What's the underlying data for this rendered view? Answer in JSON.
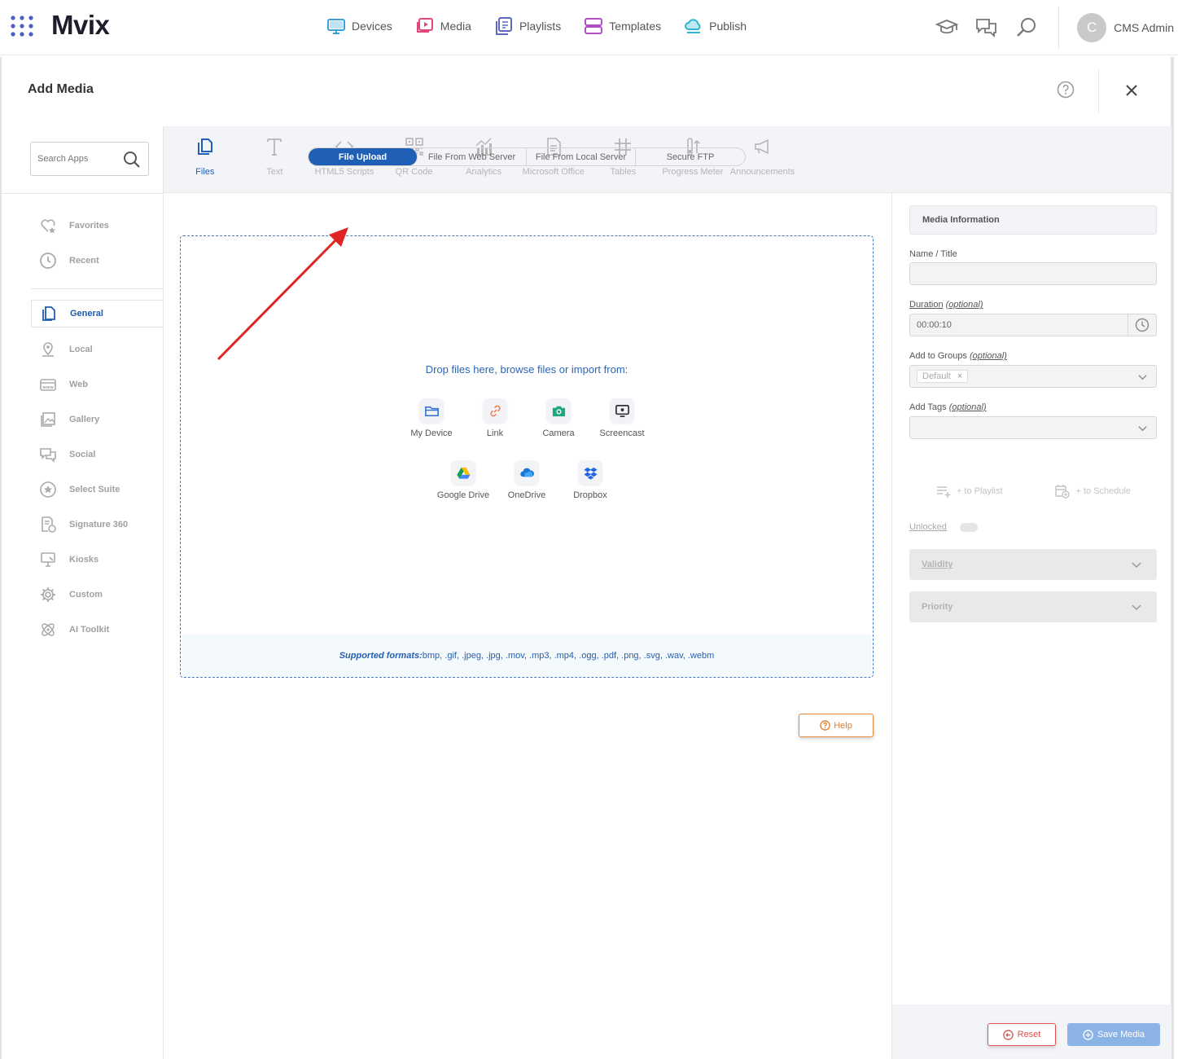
{
  "app": {
    "logo": "Mvix",
    "nav": [
      {
        "label": "Devices",
        "icon": "monitor-icon",
        "color": "#3aa0d8"
      },
      {
        "label": "Media",
        "icon": "media-play-icon",
        "color": "#e0457b"
      },
      {
        "label": "Playlists",
        "icon": "playlist-icon",
        "color": "#5b6abf"
      },
      {
        "label": "Templates",
        "icon": "templates-icon",
        "color": "#b04fc7"
      },
      {
        "label": "Publish",
        "icon": "cloud-publish-icon",
        "color": "#2fb3d0"
      }
    ],
    "user": {
      "initial": "C",
      "name": "CMS Admin"
    }
  },
  "panel": {
    "title": "Add Media",
    "search_placeholder": "Search Apps"
  },
  "sidebar": {
    "top_items": [
      {
        "label": "Favorites",
        "icon": "heart-star-icon"
      },
      {
        "label": "Recent",
        "icon": "clock-icon"
      }
    ],
    "items": [
      {
        "label": "General",
        "icon": "file-copy-icon",
        "active": true
      },
      {
        "label": "Local",
        "icon": "location-pin-icon"
      },
      {
        "label": "Web",
        "icon": "web-icon"
      },
      {
        "label": "Gallery",
        "icon": "gallery-icon"
      },
      {
        "label": "Social",
        "icon": "social-chat-icon"
      },
      {
        "label": "Select Suite",
        "icon": "star-circle-icon"
      },
      {
        "label": "Signature 360",
        "icon": "signature-icon"
      },
      {
        "label": "Kiosks",
        "icon": "kiosk-icon"
      },
      {
        "label": "Custom",
        "icon": "gear-icon"
      },
      {
        "label": "AI Toolkit",
        "icon": "atom-icon"
      }
    ]
  },
  "apps": [
    {
      "label": "Files",
      "icon": "files-icon",
      "active": true
    },
    {
      "label": "Text",
      "icon": "text-icon"
    },
    {
      "label": "HTML5 Scripts",
      "icon": "code-icon"
    },
    {
      "label": "QR Code",
      "icon": "qr-code-icon"
    },
    {
      "label": "Analytics",
      "icon": "analytics-icon"
    },
    {
      "label": "Microsoft Office",
      "icon": "document-icon"
    },
    {
      "label": "Tables",
      "icon": "table-grid-icon"
    },
    {
      "label": "Progress Meter",
      "icon": "progress-meter-icon"
    },
    {
      "label": "Announcements",
      "icon": "megaphone-icon"
    }
  ],
  "tabs": [
    {
      "label": "File Upload",
      "active": true
    },
    {
      "label": "File From Web Server"
    },
    {
      "label": "File From Local Server"
    },
    {
      "label": "Secure FTP"
    }
  ],
  "upload": {
    "prompt": "Drop files here, browse files or import from:",
    "sources_row1": [
      {
        "label": "My Device",
        "icon": "folder-icon"
      },
      {
        "label": "Link",
        "icon": "link-icon"
      },
      {
        "label": "Camera",
        "icon": "camera-icon"
      },
      {
        "label": "Screencast",
        "icon": "screencast-icon"
      }
    ],
    "sources_row2": [
      {
        "label": "Google Drive",
        "icon": "google-drive-icon"
      },
      {
        "label": "OneDrive",
        "icon": "onedrive-icon"
      },
      {
        "label": "Dropbox",
        "icon": "dropbox-icon"
      }
    ],
    "formats_label": "Supported formats:",
    "formats": "bmp, .gif, .jpeg, .jpg, .mov, .mp3, .mp4, .ogg, .pdf, .png, .svg, .wav, .webm"
  },
  "help_button": "Help",
  "media_info": {
    "header": "Media Information",
    "name_label": "Name / Title",
    "name_value": "",
    "duration_label": "Duration",
    "duration_hint": "(optional)",
    "duration_value": "00:00:10",
    "groups_label": "Add to Groups",
    "groups_hint": "(optional)",
    "groups_chip": "Default",
    "tags_label": "Add Tags",
    "tags_hint": "(optional)",
    "to_playlist": "+ to Playlist",
    "to_schedule": "+ to Schedule",
    "unlocked": "Unlocked",
    "validity": "Validity",
    "priority": "Priority",
    "reset": "Reset",
    "save": "Save Media"
  }
}
